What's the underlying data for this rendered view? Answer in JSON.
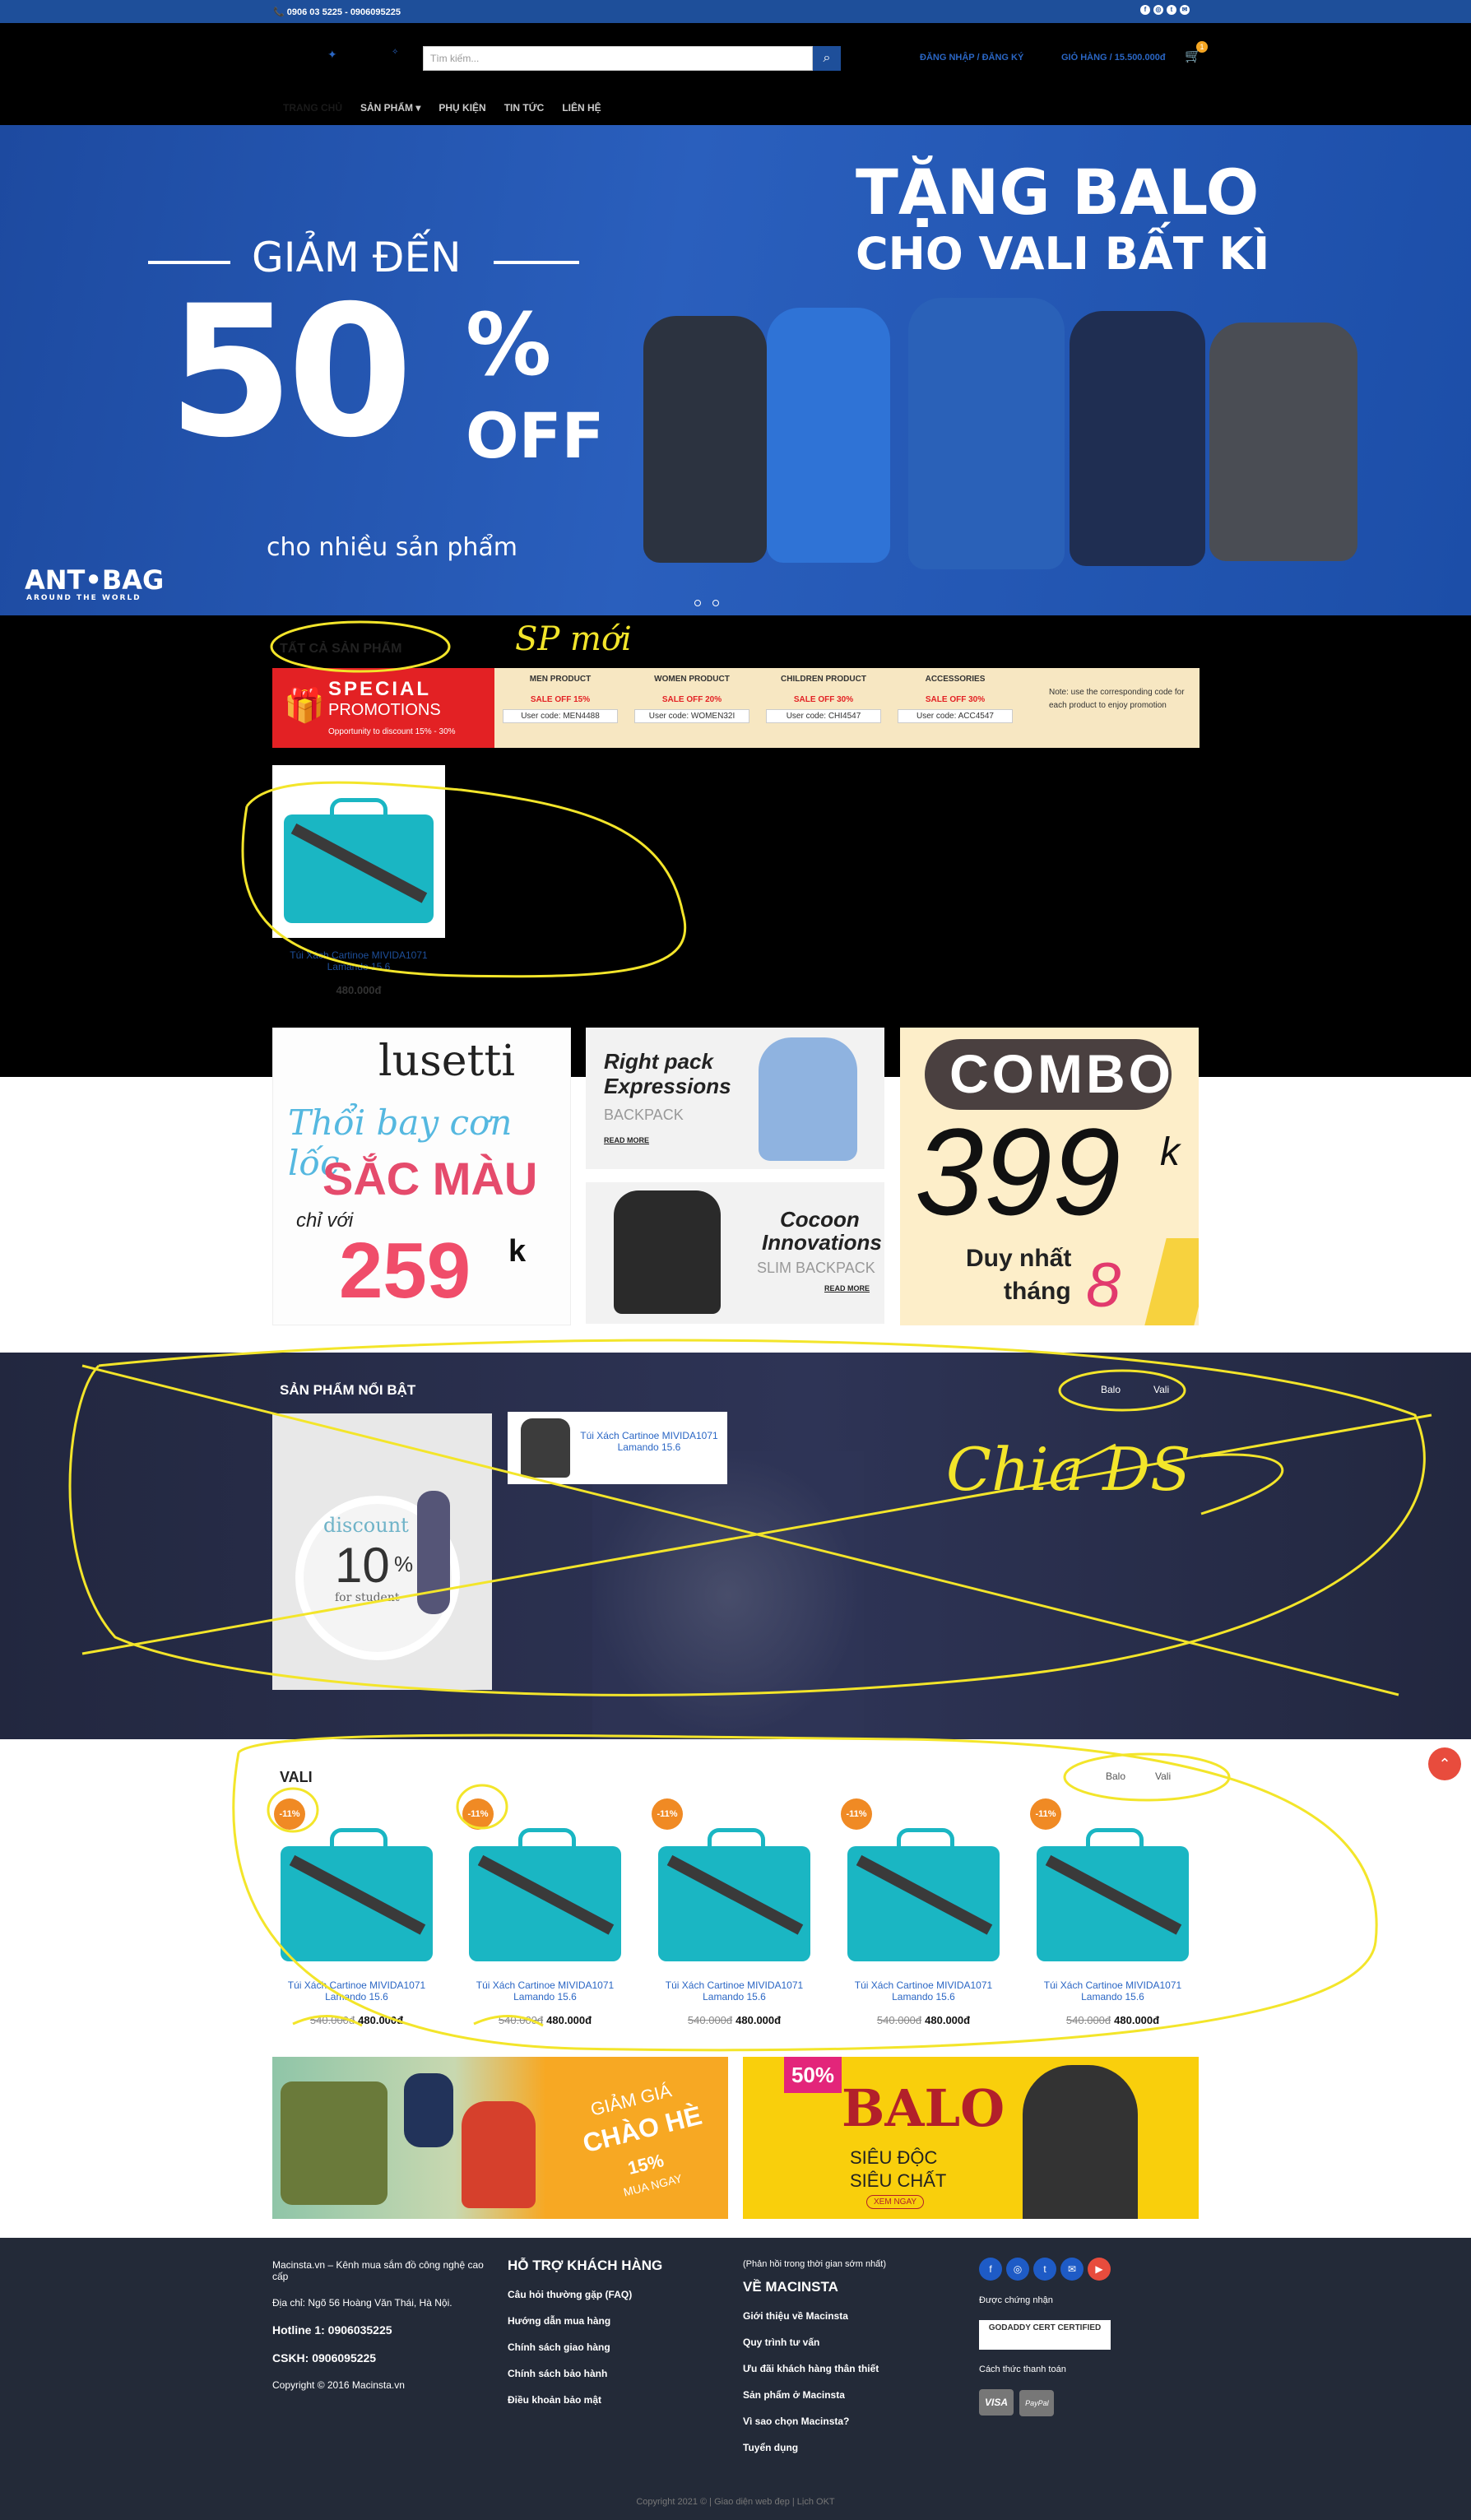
{
  "topbar": {
    "phone": "📞 0906 03 5225 - 0906095225"
  },
  "header": {
    "search_placeholder": "Tìm kiếm...",
    "login": "ĐĂNG NHẬP / ĐĂNG KÝ",
    "cart": "GIỎ HÀNG / 15.500.000đ",
    "cart_count": "1",
    "nav": [
      "TRANG CHỦ",
      "SẢN PHẨM ▾",
      "PHỤ KIỆN",
      "TIN TỨC",
      "LIÊN HỆ"
    ]
  },
  "hero": {
    "left_small": "GIẢM ĐẾN",
    "big": "50",
    "pct": "%",
    "off": "OFF",
    "sub": "cho nhiều sản phẩm",
    "logo": "ANT•BAG",
    "logo_sub": "AROUND THE WORLD",
    "right1": "TẶNG BALO",
    "right2": "CHO VALI BẤT KÌ"
  },
  "all_products": {
    "title": "TẤT CẢ SẢN PHẨM"
  },
  "promo": {
    "title1": "SPECIAL",
    "title2": "PROMOTIONS",
    "sub": "Opportunity to discount 15% - 30%",
    "cols": [
      {
        "head": "MEN PRODUCT",
        "sale": "SALE OFF 15%",
        "code": "User code: MEN4488"
      },
      {
        "head": "WOMEN PRODUCT",
        "sale": "SALE OFF 20%",
        "code": "User code: WOMEN32I"
      },
      {
        "head": "CHILDREN PRODUCT",
        "sale": "SALE OFF 30%",
        "code": "User code: CHI4547"
      },
      {
        "head": "ACCESSORIES",
        "sale": "SALE OFF 30%",
        "code": "User code: ACC4547"
      }
    ],
    "note": "Note: use the corresponding code for each product to enjoy promotion"
  },
  "first_product": {
    "title": "Túi Xách Cartinoe MIVIDA1071 Lamando 15.6",
    "price": "480.000đ"
  },
  "banners": {
    "lusetti": "lusetti",
    "lusetti_line1": "Thổi bay cơn lốc",
    "lusetti_line2": "SẮC MÀU",
    "lusetti_line3": "chỉ với",
    "lusetti_price": "259",
    "lusetti_k": "k",
    "right_pack1": "Right pack",
    "right_pack2": "Expressions",
    "backpack": "BACKPACK",
    "read_more": "READ MORE",
    "cocoon1": "Cocoon",
    "cocoon2": "Innovations",
    "slim": "SLIM BACKPACK",
    "combo": "COMBO",
    "combo_price": "399",
    "combo_k": "k",
    "combo_sub1": "Duy nhất",
    "combo_sub2": "tháng",
    "combo_month": "8"
  },
  "featured": {
    "title": "SẢN PHẨM NỔI BẬT",
    "tabs": [
      "Balo",
      "Vali"
    ],
    "discount": "discount",
    "discount_pct": "10",
    "discount_sub": "for student",
    "product": "Túi Xách Cartinoe MIVIDA1071 Lamando 15.6"
  },
  "vali": {
    "title": "VALI",
    "tabs": [
      "Balo",
      "Vali"
    ],
    "products": [
      {
        "badge": "-11%",
        "title": "Túi Xách Cartinoe MIVIDA1071 Lamando 15.6",
        "old": "540.000đ",
        "price": "480.000đ"
      },
      {
        "badge": "-11%",
        "title": "Túi Xách Cartinoe MIVIDA1071 Lamando 15.6",
        "old": "540.000đ",
        "price": "480.000đ"
      },
      {
        "badge": "-11%",
        "title": "Túi Xách Cartinoe MIVIDA1071 Lamando 15.6",
        "old": "540.000đ",
        "price": "480.000đ"
      },
      {
        "badge": "-11%",
        "title": "Túi Xách Cartinoe MIVIDA1071 Lamando 15.6",
        "old": "540.000đ",
        "price": "480.000đ"
      },
      {
        "badge": "-11%",
        "title": "Túi Xách Cartinoe MIVIDA1071 Lamando 15.6",
        "old": "540.000đ",
        "price": "480.000đ"
      }
    ]
  },
  "bottom_banners": {
    "left1": "GIẢM GIÁ",
    "left2": "CHÀO HÈ",
    "left3": "15%",
    "left4": "MUA NGAY",
    "right_pct": "50%",
    "right1": "BALO",
    "right2": "SIÊU ĐỘC",
    "right3": "SIÊU CHẤT",
    "right_btn": "XEM NGAY"
  },
  "footer": {
    "about": "Macinsta.vn – Kênh mua sắm đồ công nghệ cao cấp",
    "address": "Địa chỉ: Ngõ 56 Hoàng Văn Thái, Hà Nội.",
    "hotline": "Hotline 1: 0906035225",
    "cskh": "CSKH: 0906095225",
    "copyright": "Copyright © 2016 Macinsta.vn",
    "support_title": "HỖ TRỢ KHÁCH HÀNG",
    "support": [
      "Câu hỏi thường gặp (FAQ)",
      "Hướng dẫn mua hàng",
      "Chính sách giao hàng",
      "Chính sách bảo hành",
      "Điều khoản bảo mật"
    ],
    "feedback": "(Phản hồi trong thời gian sớm nhất)",
    "about_title": "VỀ MACINSTA",
    "about_links": [
      "Giới thiệu về Macinsta",
      "Quy trình tư vấn",
      "Ưu đãi khách hàng thân thiết",
      "Sản phẩm ở Macinsta",
      "Vì sao chọn Macinsta?",
      "Tuyển dụng"
    ],
    "certified_label": "Được chứng nhận",
    "certified": "GODADDY CERT CERTIFIED",
    "payment_label": "Cách thức thanh toán",
    "visa": "VISA",
    "paypal": "PayPal",
    "bottom": "Copyright 2021 © | Giao diện web đẹp | Lịch OKT"
  },
  "notes": {
    "sp_moi": "SP mới",
    "chia_ds": "Chia DS"
  }
}
